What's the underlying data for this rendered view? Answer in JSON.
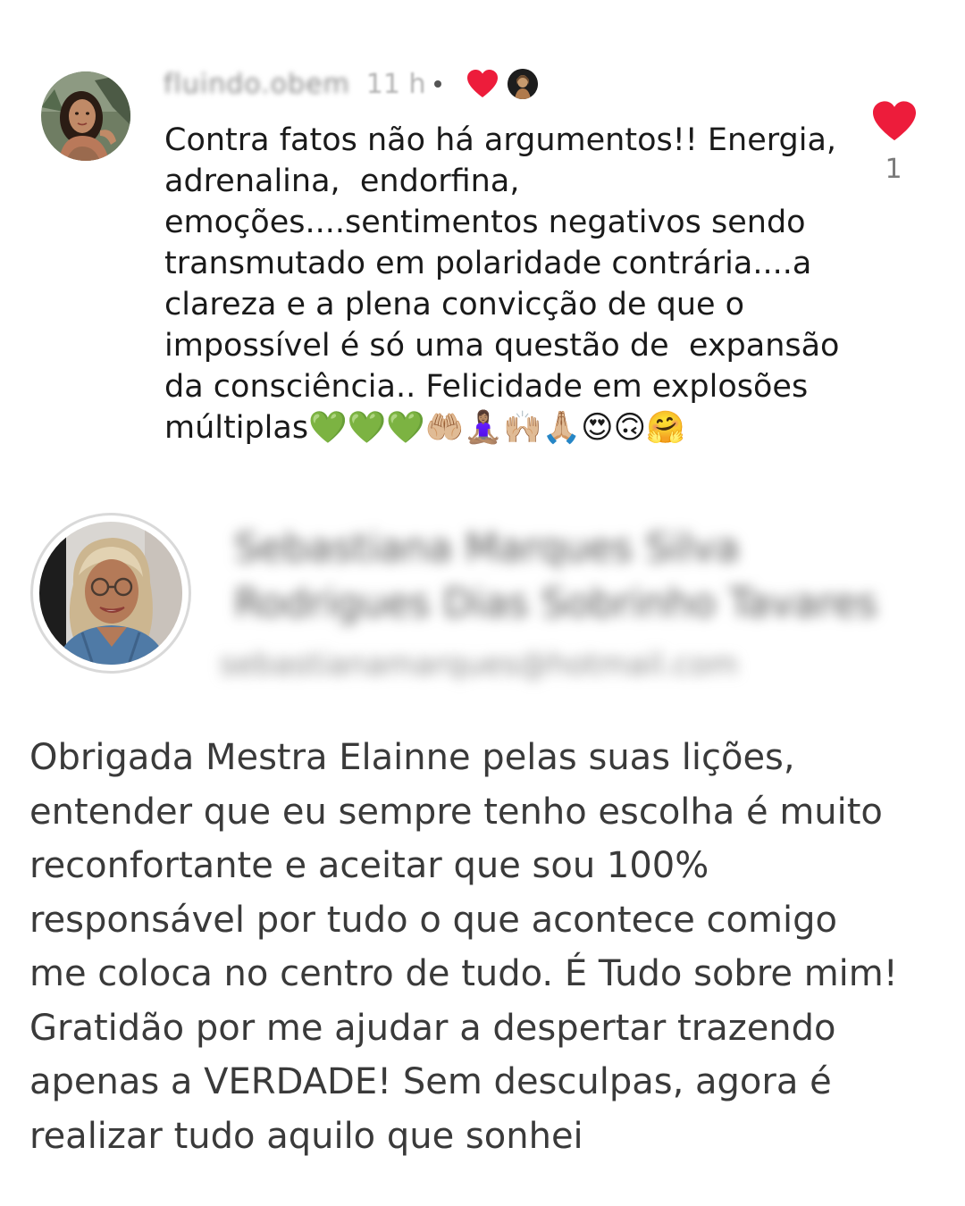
{
  "comment1": {
    "username": "fluindo.obem",
    "time": "11 h",
    "reacted_heart_icon": "heart-icon",
    "text": "Contra fatos não há argumentos!! Energia,\nadrenalina,  endorfina,\nemoções....sentimentos negativos sendo\ntransmutado em polaridade contrária....a\nclareza e a plena convicção de que o\nimpossível é só uma questão de  expansão\nda consciência.. Felicidade em explosões\nmúltiplas💚💚💚🤲🏼🧘🏽‍♀️🙌🏼🙏🏼😍🙃🤗",
    "like_icon": "heart-icon",
    "like_count": "1",
    "heart_color": "#ed1c3b"
  },
  "comment2": {
    "name": "Sebastiana Marques Silva Rodrigues Dias Sobrinho Tavares",
    "email": "sebastianamarques@hotmail.com",
    "text": "Obrigada Mestra Elainne pelas suas lições,\nentender que eu sempre tenho escolha é muito\nreconfortante e aceitar que sou 100%\nresponsável por tudo o que acontece comigo\nme coloca no centro de tudo. É Tudo sobre mim!\nGratidão por me ajudar a despertar trazendo\napenas a VERDADE! Sem desculpas, agora é\nrealizar tudo aquilo que sonhei"
  }
}
